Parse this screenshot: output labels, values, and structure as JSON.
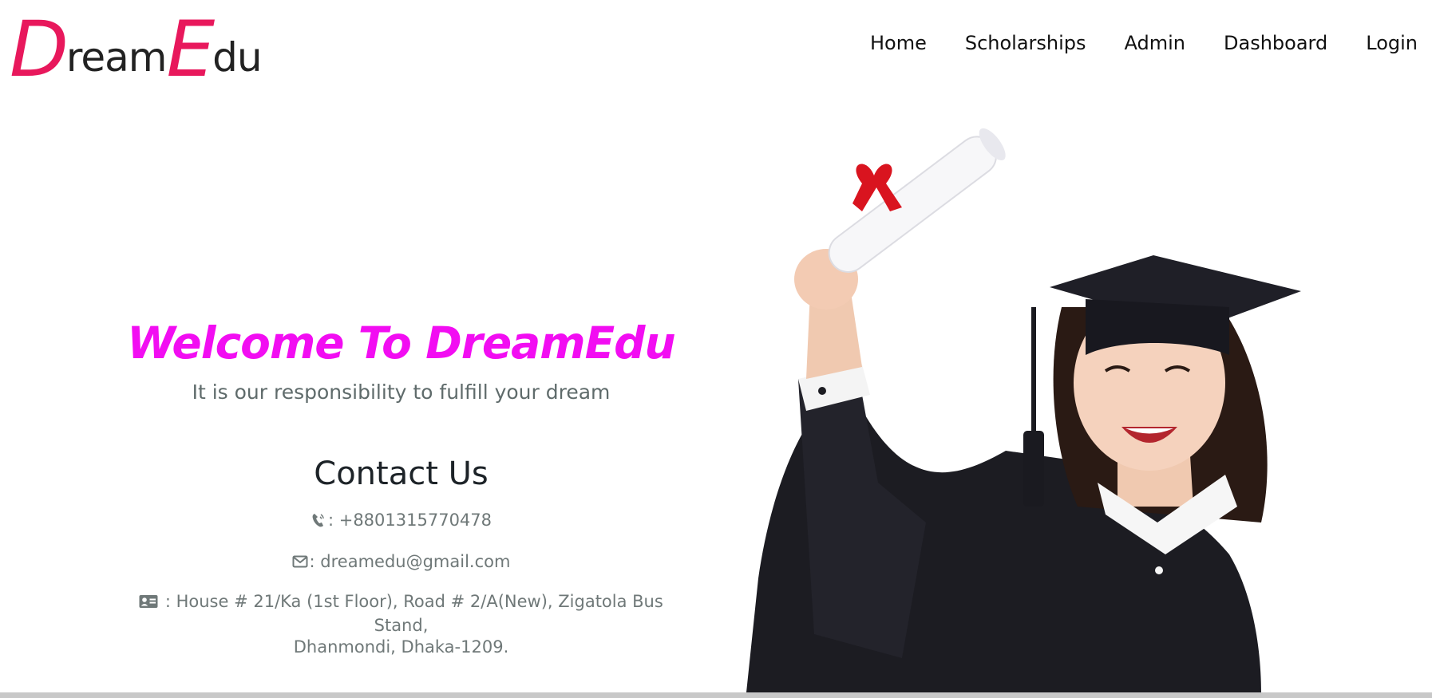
{
  "logo": {
    "letter_d": "D",
    "part_ream": "ream",
    "letter_e": "E",
    "part_du": "du",
    "accent_color": "#e8185c"
  },
  "nav": {
    "items": [
      {
        "label": "Home"
      },
      {
        "label": "Scholarships"
      },
      {
        "label": "Admin"
      },
      {
        "label": "Dashboard"
      },
      {
        "label": "Login"
      }
    ]
  },
  "hero": {
    "title": "Welcome To DreamEdu",
    "title_color": "#f20df2",
    "tagline": "It is our responsibility to fulfill your dream"
  },
  "contact": {
    "title": "Contact Us",
    "phone": ": +8801315770478",
    "email": ": dreamedu@gmail.com",
    "address_line1": " : House # 21/Ka (1st Floor), Road # 2/A(New), Zigatola Bus Stand,",
    "address_line2": "Dhanmondi, Dhaka-1209.",
    "phone_icon": "phone-icon",
    "email_icon": "envelope-icon",
    "address_icon": "address-card-icon"
  }
}
